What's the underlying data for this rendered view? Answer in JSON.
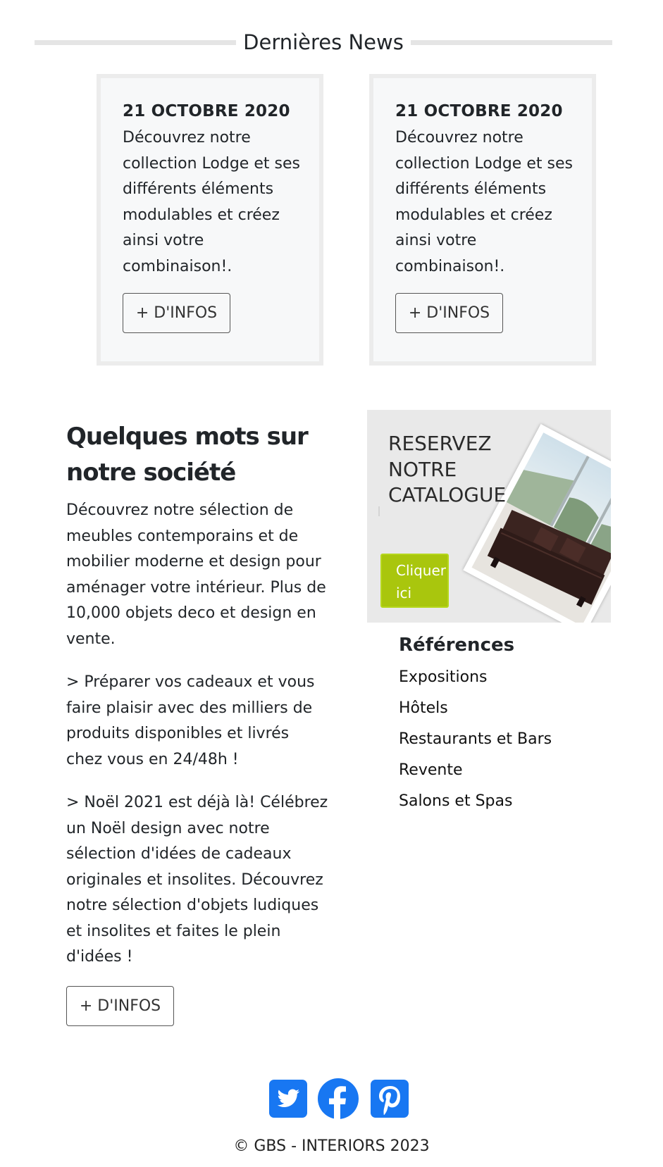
{
  "news": {
    "heading": "Dernières News",
    "cards": [
      {
        "date": "21 OCTOBRE 2020",
        "text": "Découvrez notre collection Lodge et ses différents éléments modulables et créez ainsi votre combinaison!.",
        "button": "+ D'INFOS"
      },
      {
        "date": "21 OCTOBRE 2020",
        "text": "Découvrez notre collection Lodge et ses différents éléments modulables et créez ainsi votre combinaison!.",
        "button": "+ D'INFOS"
      }
    ]
  },
  "about": {
    "title": "Quelques mots sur notre société",
    "paragraphs": [
      "Découvrez notre sélection de meubles contemporains et de mobilier moderne et design pour aménager votre intérieur. Plus de 10,000 objets deco et design en vente.",
      "> Préparer vos cadeaux et vous faire plaisir avec des milliers de produits disponibles et livrés chez vous en 24/48h !",
      "> Noël 2021 est déjà là! Célébrez un Noël design avec notre sélection d'idées de cadeaux originales et insolites. Découvrez notre sélection d'objets ludiques et insolites et faites le plein d'idées !"
    ],
    "button": "+ D'INFOS"
  },
  "catalogue": {
    "title": "RESERVEZ NOTRE CATALOGUE",
    "button": "Cliquer ici",
    "button_color": "#a9c60d"
  },
  "references": {
    "title": "Références",
    "items": [
      "Expositions",
      "Hôtels",
      "Restaurants et Bars",
      "Revente",
      "Salons et Spas"
    ]
  },
  "social": {
    "color": "#1877f2",
    "icons": [
      "twitter-icon",
      "facebook-icon",
      "pinterest-icon"
    ]
  },
  "footer": {
    "copyright": "© GBS - INTERIORS 2023"
  }
}
